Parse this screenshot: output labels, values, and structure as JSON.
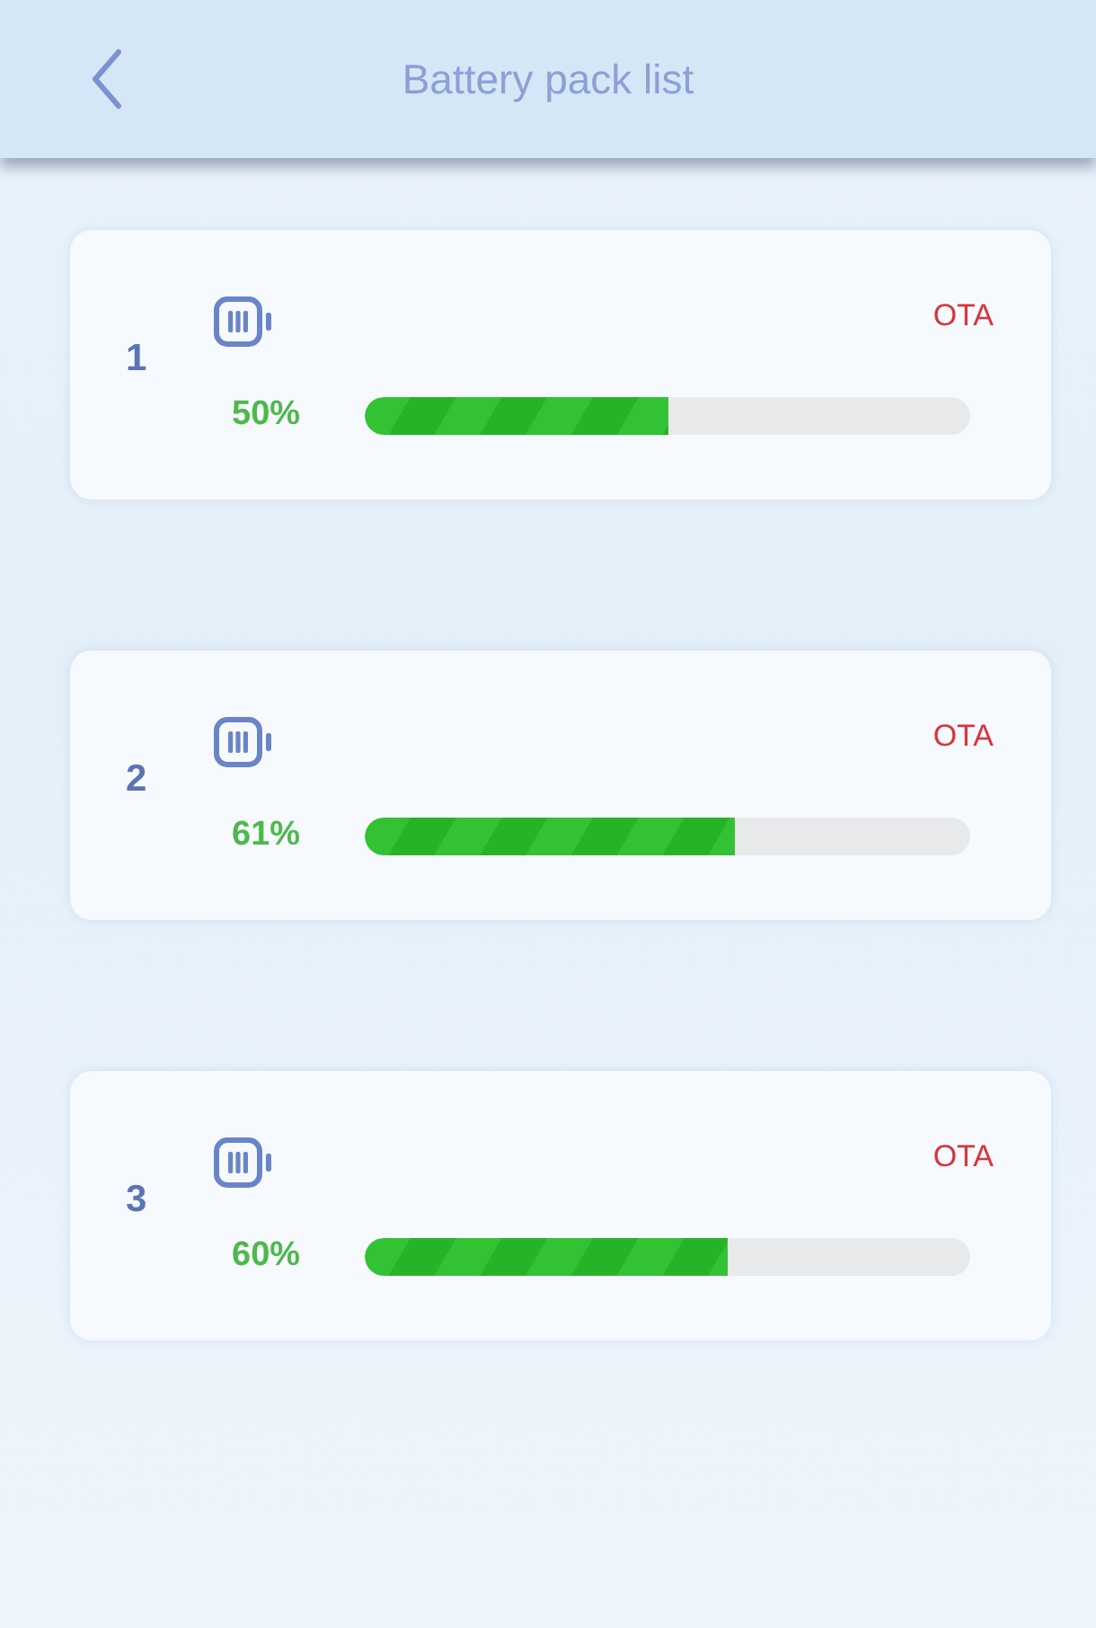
{
  "header": {
    "title": "Battery pack list"
  },
  "packs": [
    {
      "number": "1",
      "action": "OTA",
      "reading": "50%",
      "level": 0.5
    },
    {
      "number": "2",
      "action": "OTA",
      "reading": "61%",
      "level": 0.61
    },
    {
      "number": "3",
      "action": "OTA",
      "reading": "60%",
      "level": 0.6
    }
  ]
}
